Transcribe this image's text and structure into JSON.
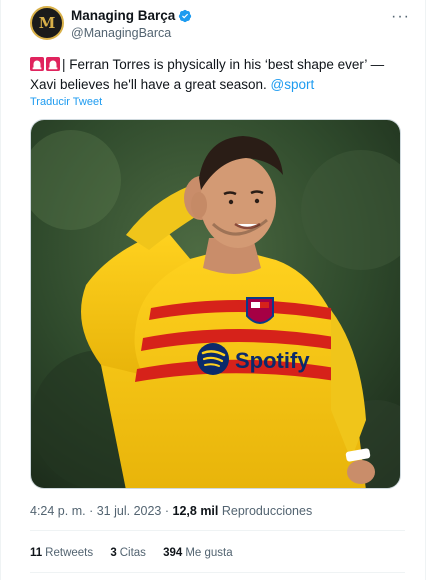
{
  "author": {
    "name": "Managing Barça",
    "handle": "@ManagingBarca",
    "avatar_text": "M",
    "verified": true
  },
  "tweet": {
    "text": "| Ferran Torres is physically in his ‘best shape ever’ — Xavi believes he'll have a great season.",
    "mention": "@sport",
    "translate_label": "Traducir Tweet"
  },
  "media": {
    "shirt_text": "Spotify"
  },
  "meta": {
    "time": "4:24 p. m.",
    "separator": "·",
    "date": "31 jul. 2023",
    "views_count": "12,8 mil",
    "views_label": "Reproducciones"
  },
  "stats": {
    "retweets_count": "11",
    "retweets_label": "Retweets",
    "quotes_count": "3",
    "quotes_label": "Citas",
    "likes_count": "394",
    "likes_label": "Me gusta"
  },
  "colors": {
    "accent": "#1d9bf0",
    "secondary_text": "#536471",
    "jersey": "#f6c60f"
  },
  "icons": [
    "siren-icon",
    "verified-badge-icon",
    "more-options-icon"
  ]
}
